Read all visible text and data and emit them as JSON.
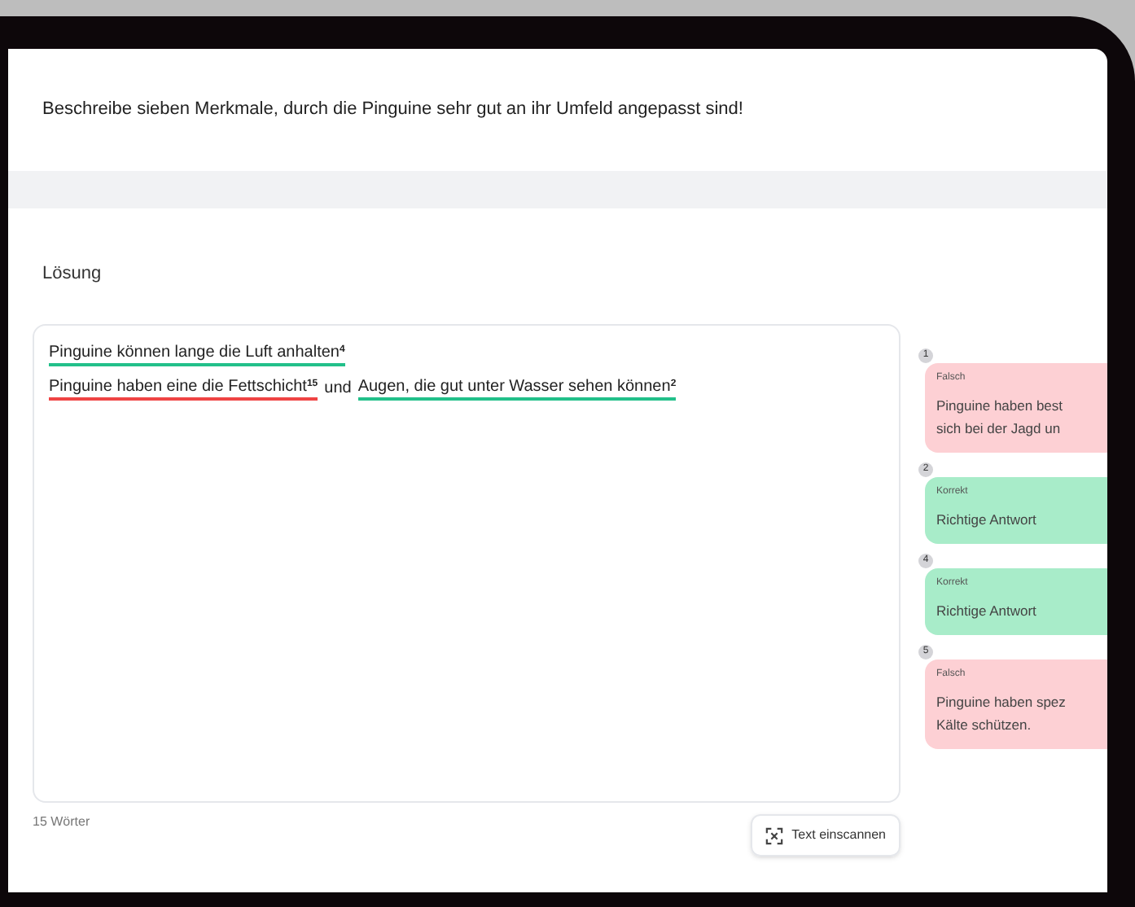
{
  "question": "Beschreibe sieben Merkmale, durch die Pinguine sehr gut an ihr Umfeld angepasst sind!",
  "section_title": "Lösung",
  "answer_lines": [
    {
      "segments": [
        {
          "text": "Pinguine können lange die Luft anhalten",
          "kind": "correct",
          "mark": "4"
        }
      ]
    },
    {
      "segments": [
        {
          "text": "Pinguine haben eine die Fettschicht",
          "kind": "wrong",
          "mark": "15"
        },
        {
          "text": "und",
          "kind": "plain"
        },
        {
          "text": "Augen, die gut unter Wasser sehen können",
          "kind": "correct",
          "mark": "2"
        }
      ]
    }
  ],
  "word_count": "15 Wörter",
  "scan_button": "Text einscannen",
  "feedback": [
    {
      "number": "1",
      "kind": "wrong",
      "verdict": "Falsch",
      "lines": [
        "Pinguine haben best",
        "sich bei der Jagd un"
      ]
    },
    {
      "number": "2",
      "kind": "correct",
      "verdict": "Korrekt",
      "lines": [
        "Richtige Antwort"
      ]
    },
    {
      "number": "4",
      "kind": "correct",
      "verdict": "Korrekt",
      "lines": [
        "Richtige Antwort"
      ]
    },
    {
      "number": "5",
      "kind": "wrong",
      "verdict": "Falsch",
      "lines": [
        "Pinguine haben spez",
        "Kälte schützen."
      ]
    }
  ]
}
